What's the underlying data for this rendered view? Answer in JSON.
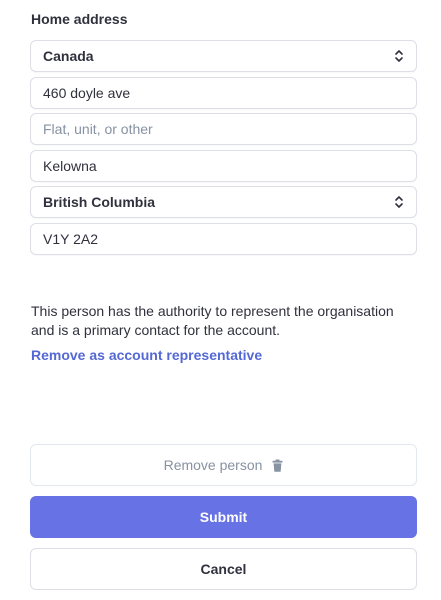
{
  "address": {
    "section_label": "Home address",
    "country": "Canada",
    "line1": "460 doyle ave",
    "line2_placeholder": "Flat, unit, or other",
    "city": "Kelowna",
    "province": "British Columbia",
    "postal_code": "V1Y 2A2"
  },
  "representative": {
    "description": "This person has the authority to represent the organisation and is a primary contact for the account.",
    "remove_link": "Remove as account representative"
  },
  "actions": {
    "remove_person_label": "Remove person",
    "submit_label": "Submit",
    "cancel_label": "Cancel"
  },
  "colors": {
    "accent": "#6772e5",
    "link": "#5469d4",
    "muted": "#8792a2"
  },
  "icons": {
    "select_chevron": "chevron-up-down-icon",
    "remove": "trash-icon"
  }
}
